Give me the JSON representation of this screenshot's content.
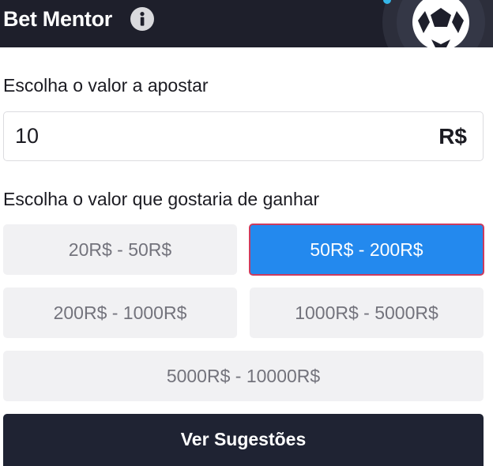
{
  "header": {
    "title": "Bet Mentor",
    "info_icon": "info-icon",
    "decoration_icon": "soccer-ball-icon"
  },
  "stake": {
    "label": "Escolha o valor a apostar",
    "value": "10",
    "currency": "R$"
  },
  "winnings": {
    "label": "Escolha o valor que gostaria de ganhar",
    "options": [
      {
        "label": "20R$ - 50R$",
        "selected": false
      },
      {
        "label": "50R$ - 200R$",
        "selected": true
      },
      {
        "label": "200R$ - 1000R$",
        "selected": false
      },
      {
        "label": "1000R$ - 5000R$",
        "selected": false
      },
      {
        "label": "5000R$ - 10000R$",
        "selected": false
      }
    ]
  },
  "submit": {
    "label": "Ver Sugestões"
  },
  "colors": {
    "header_bg": "#1e1f2b",
    "selected_bg": "#2389ee",
    "selected_border": "#cc3b5e",
    "option_bg": "#f1f1f3",
    "button_bg": "#1f2333"
  }
}
